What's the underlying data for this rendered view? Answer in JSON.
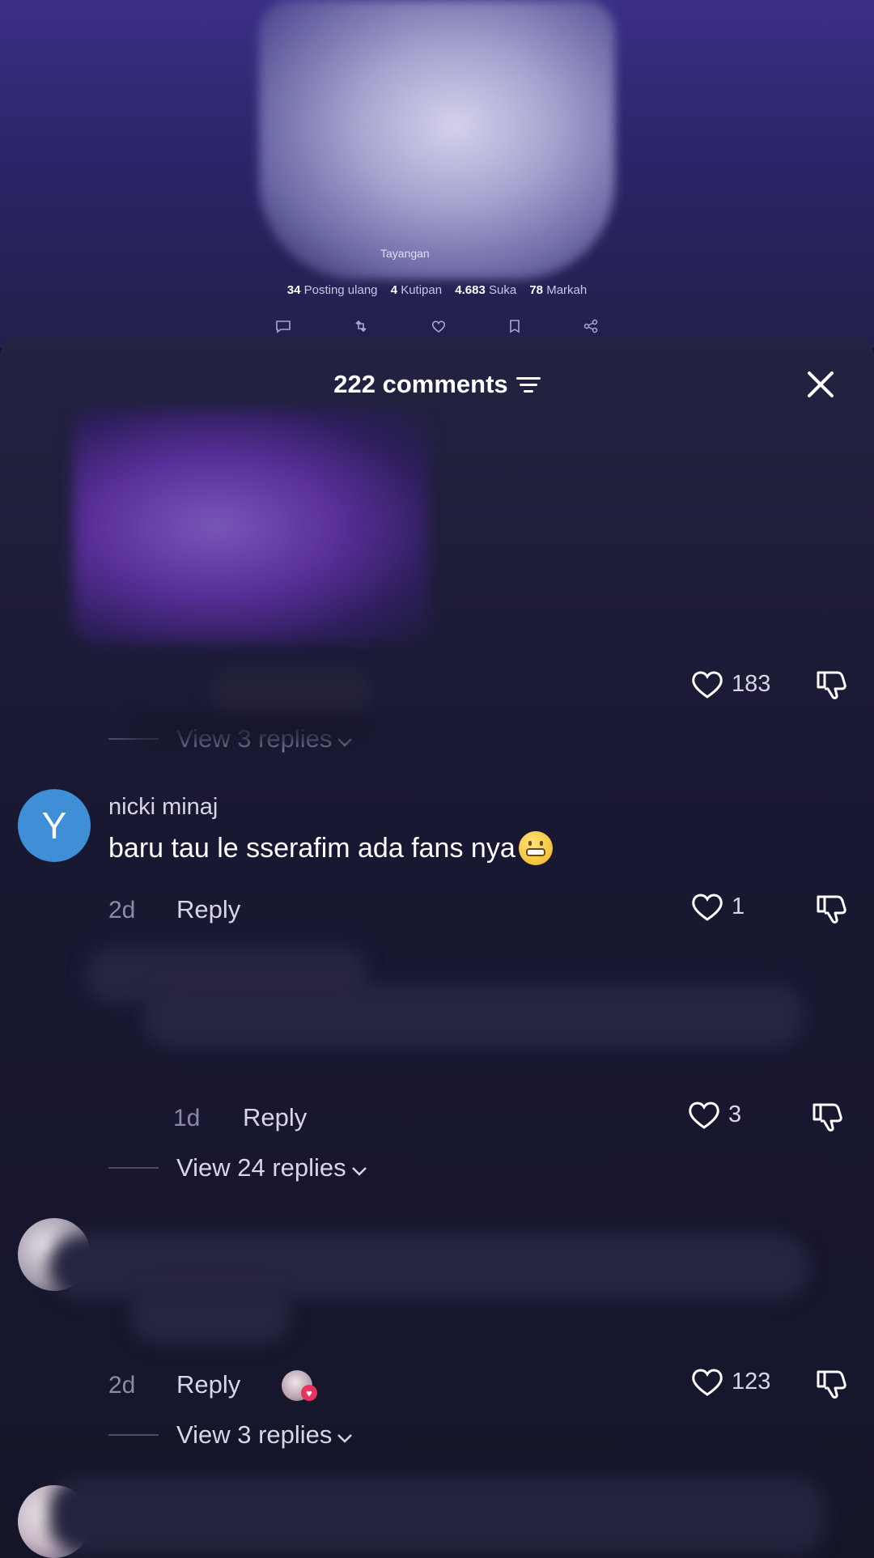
{
  "post": {
    "views_text": "Tayangan",
    "stats": [
      {
        "value": "34",
        "label": "Posting ulang"
      },
      {
        "value": "4",
        "label": "Kutipan"
      },
      {
        "value": "4.683",
        "label": "Suka"
      },
      {
        "value": "78",
        "label": "Markah"
      }
    ],
    "action_icons": [
      "comment-icon",
      "repost-icon",
      "heart-icon",
      "bookmark-icon",
      "share-icon"
    ]
  },
  "sheet": {
    "title": "222 comments",
    "sort_icon": "sort-icon",
    "close_icon": "close-icon"
  },
  "comments": [
    {
      "username": "",
      "text": "",
      "likes": "183",
      "view_replies": "View 3 replies"
    },
    {
      "avatar_letter": "Y",
      "avatar_color": "#3e8fd6",
      "username": "nicki minaj",
      "text": "baru tau le sserafim ada fans nya",
      "emoji": "grimacing-face",
      "date": "2d",
      "reply_label": "Reply",
      "likes": "1"
    },
    {
      "date": "1d",
      "reply_label": "Reply",
      "likes": "3",
      "view_replies": "View 24 replies"
    },
    {
      "date": "2d",
      "reply_label": "Reply",
      "likes": "123",
      "view_replies": "View 3 replies"
    }
  ],
  "colors": {
    "accent_like_heart": "#e8335f",
    "sheet_background": "#15152a",
    "muted_text": "#8c8aa6"
  }
}
